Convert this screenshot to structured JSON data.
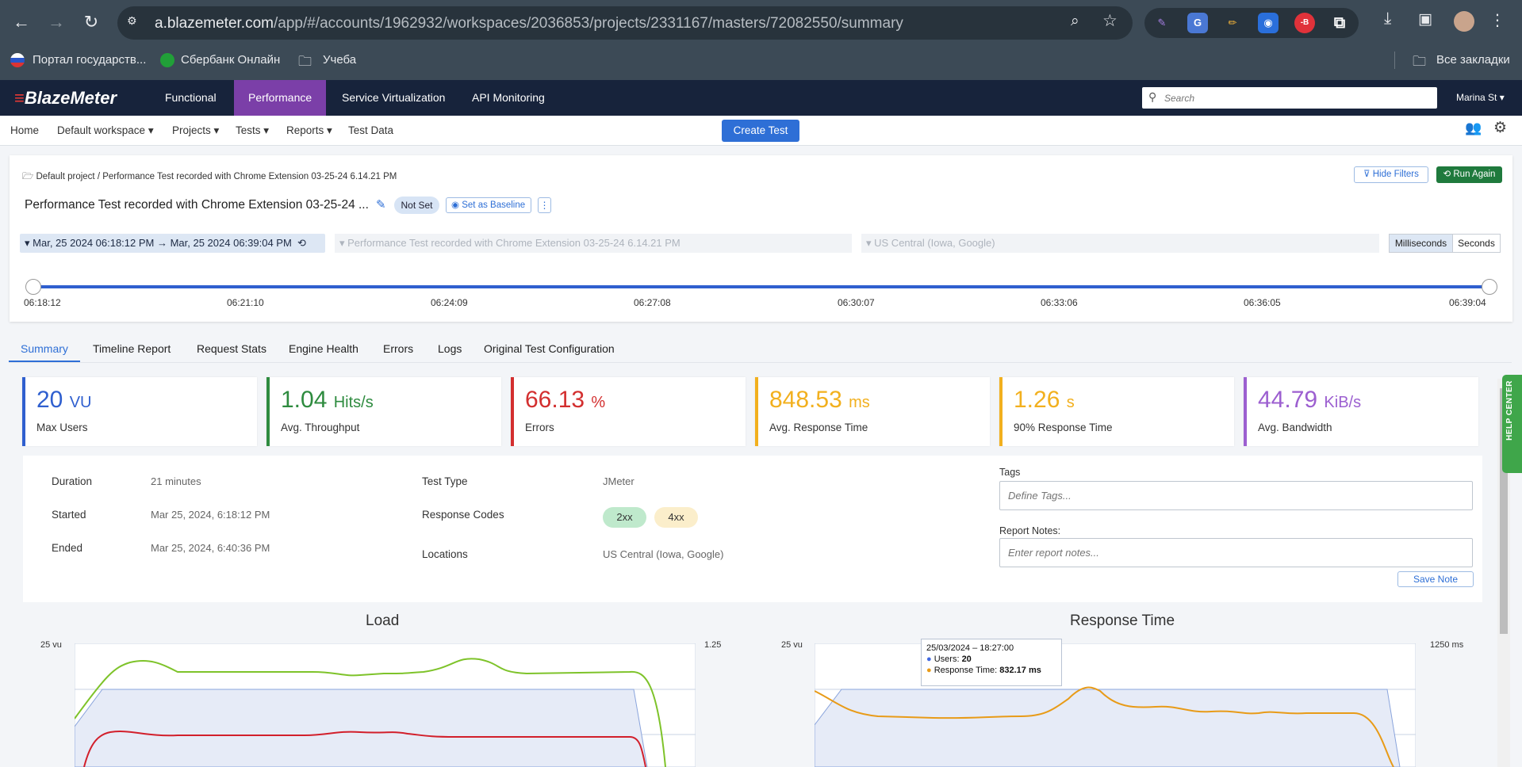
{
  "browser": {
    "url_host": "a.blazemeter.com",
    "url_path": "/app/#/accounts/1962932/workspaces/2036853/projects/2331167/masters/72082550/summary",
    "bookmarks": [
      "Портал государств...",
      "Сбербанк Онлайн",
      "Учеба"
    ],
    "all_bookmarks": "Все закладки"
  },
  "app": {
    "logo": "BlazeMeter",
    "nav": [
      "Functional",
      "Performance",
      "Service Virtualization",
      "API Monitoring"
    ],
    "search_placeholder": "Search",
    "user": "Marina St"
  },
  "subnav": {
    "home": "Home",
    "workspace": "Default workspace",
    "projects": "Projects",
    "tests": "Tests",
    "reports": "Reports",
    "test_data": "Test Data",
    "create_test": "Create Test"
  },
  "header": {
    "breadcrumb": "Default project / Performance Test recorded with Chrome Extension 03-25-24 6.14.21 PM",
    "title": "Performance Test recorded with Chrome Extension 03-25-24 ...",
    "status": "Not Set",
    "set_baseline": "Set as Baseline",
    "hide_filters": "Hide Filters",
    "run_again": "Run Again",
    "date_range": "Mar, 25 2024 06:18:12 PM → Mar, 25 2024 06:39:04 PM",
    "test_filter": "Performance Test recorded with Chrome Extension 03-25-24 6.14.21 PM",
    "location_filter": "US Central (Iowa, Google)",
    "unit_ms": "Milliseconds",
    "unit_s": "Seconds",
    "timeline_ticks": [
      "06:18:12",
      "06:21:10",
      "06:24:09",
      "06:27:08",
      "06:30:07",
      "06:33:06",
      "06:36:05",
      "06:39:04"
    ]
  },
  "tabs": [
    "Summary",
    "Timeline Report",
    "Request Stats",
    "Engine Health",
    "Errors",
    "Logs",
    "Original Test Configuration"
  ],
  "stats": [
    {
      "value": "20",
      "unit": "VU",
      "label": "Max Users",
      "color": "#2f5fcf"
    },
    {
      "value": "1.04",
      "unit": "Hits/s",
      "label": "Avg. Throughput",
      "color": "#2e8b3f"
    },
    {
      "value": "66.13",
      "unit": "%",
      "label": "Errors",
      "color": "#d32f2f"
    },
    {
      "value": "848.53",
      "unit": "ms",
      "label": "Avg. Response Time",
      "color": "#f2b01e"
    },
    {
      "value": "1.26",
      "unit": "s",
      "label": "90% Response Time",
      "color": "#f2b01e"
    },
    {
      "value": "44.79",
      "unit": "KiB/s",
      "label": "Avg. Bandwidth",
      "color": "#9c5fd0"
    }
  ],
  "details": {
    "duration_label": "Duration",
    "duration": "21 minutes",
    "started_label": "Started",
    "started": "Mar 25, 2024, 6:18:12 PM",
    "ended_label": "Ended",
    "ended": "Mar 25, 2024, 6:40:36 PM",
    "test_type_label": "Test Type",
    "test_type": "JMeter",
    "response_codes_label": "Response Codes",
    "response_codes": [
      "2xx",
      "4xx"
    ],
    "locations_label": "Locations",
    "locations": "US Central (Iowa, Google)",
    "tags_label": "Tags",
    "tags_placeholder": "Define Tags...",
    "notes_label": "Report Notes:",
    "notes_placeholder": "Enter report notes...",
    "save_note": "Save Note"
  },
  "charts": {
    "load_title": "Load",
    "load_left_max": "25 vu",
    "load_right_max": "1.25",
    "rt_title": "Response Time",
    "rt_left_max": "25 vu",
    "rt_right_max": "1250 ms",
    "tooltip": {
      "date": "25/03/2024 – 18:27:00",
      "users_label": "Users:",
      "users": "20",
      "rt_label": "Response Time:",
      "rt": "832.17 ms"
    }
  },
  "help_center": "HELP CENTER"
}
